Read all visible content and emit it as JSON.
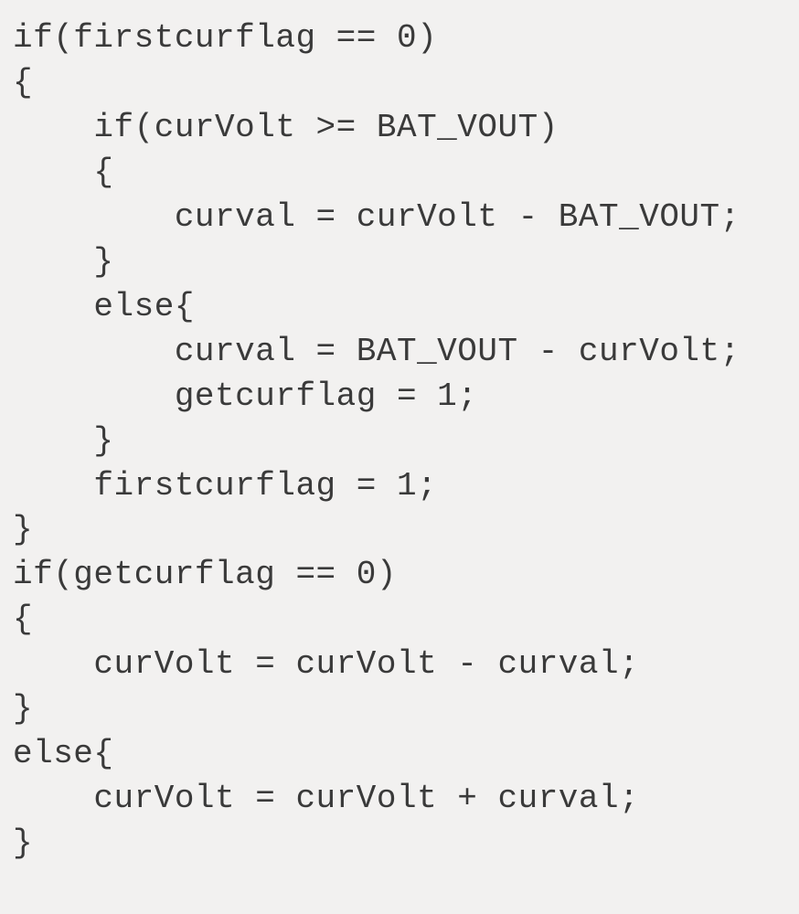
{
  "code": {
    "lines": [
      "if(firstcurflag == 0)",
      "{",
      "    if(curVolt >= BAT_VOUT)",
      "    {",
      "        curval = curVolt - BAT_VOUT;",
      "    }",
      "    else{",
      "        curval = BAT_VOUT - curVolt;",
      "        getcurflag = 1;",
      "    }",
      "    firstcurflag = 1;",
      "}",
      "if(getcurflag == 0)",
      "{",
      "    curVolt = curVolt - curval;",
      "}",
      "else{",
      "    curVolt = curVolt + curval;",
      "}"
    ]
  }
}
